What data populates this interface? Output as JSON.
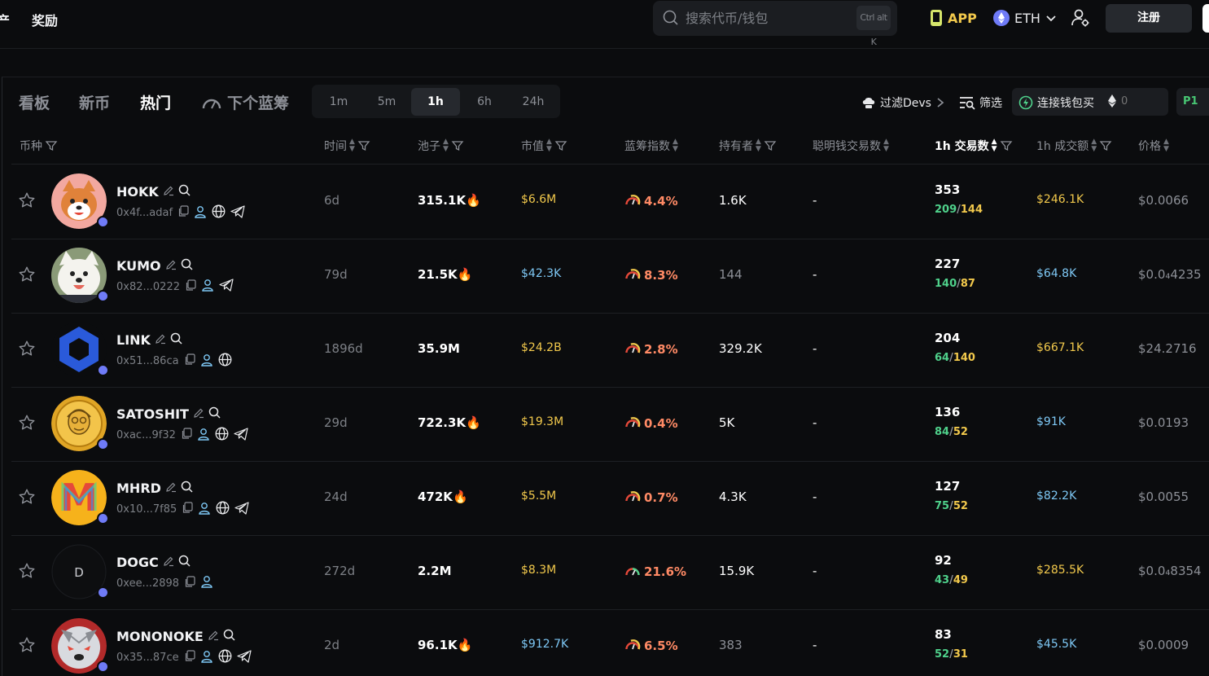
{
  "topbar": {
    "nav_assets_partial": "产",
    "nav_rewards": "奖励",
    "search_placeholder": "搜索代币/钱包",
    "search_shortcut": "Ctrl alt K",
    "app_label": "APP",
    "chain_label": "ETH",
    "signup_label": "注册"
  },
  "tabs": [
    {
      "label": "看板"
    },
    {
      "label": "新币"
    },
    {
      "label": "热门"
    },
    {
      "label": "下个蓝筹"
    }
  ],
  "time_ranges": [
    {
      "label": "1m"
    },
    {
      "label": "5m"
    },
    {
      "label": "1h"
    },
    {
      "label": "6h"
    },
    {
      "label": "24h"
    }
  ],
  "toolbar": {
    "filter_devs": "过滤Devs",
    "filter": "筛选",
    "wallet_buy": "连接钱包买",
    "buy_amount": "0",
    "preset": "P1"
  },
  "columns": {
    "token": "币种",
    "age": "时间",
    "pool": "池子",
    "market_cap": "市值",
    "bluechip": "蓝筹指数",
    "holders": "持有者",
    "smart_tx": "聪明钱交易数",
    "tx_1h": "1h 交易数",
    "vol_1h": "1h 成交额",
    "price": "价格"
  },
  "rows": [
    {
      "symbol": "HOKK",
      "address": "0x4f...adaf",
      "age": "6d",
      "pool": "315.1K",
      "market_cap": "$6.6M",
      "bluechip": "4.4%",
      "holders": "1.6K",
      "smart_tx": "-",
      "tx": "353",
      "buys": "209",
      "sells": "144",
      "volume": "$246.1K",
      "price": "$0.0066",
      "avatar_color": "#f08a72",
      "hot": true
    },
    {
      "symbol": "KUMO",
      "address": "0x82...0222",
      "age": "79d",
      "pool": "21.5K",
      "market_cap": "$42.3K",
      "bluechip": "8.3%",
      "holders": "144",
      "smart_tx": "-",
      "tx": "227",
      "buys": "140",
      "sells": "87",
      "volume": "$64.8K",
      "price": "$0.0₄4235",
      "avatar_color": "#d8d8d2",
      "hot": true
    },
    {
      "symbol": "LINK",
      "address": "0x51...86ca",
      "age": "1896d",
      "pool": "35.9M",
      "market_cap": "$24.2B",
      "bluechip": "2.8%",
      "holders": "329.2K",
      "smart_tx": "-",
      "tx": "204",
      "buys": "64",
      "sells": "140",
      "volume": "$667.1K",
      "price": "$24.2716",
      "avatar_color": "#2a5ada",
      "hot": false
    },
    {
      "symbol": "SATOSHIT",
      "address": "0xac...9f32",
      "age": "29d",
      "pool": "722.3K",
      "market_cap": "$19.3M",
      "bluechip": "0.4%",
      "holders": "5K",
      "smart_tx": "-",
      "tx": "136",
      "buys": "84",
      "sells": "52",
      "volume": "$91K",
      "price": "$0.0193",
      "avatar_color": "#e0a525",
      "hot": true
    },
    {
      "symbol": "MHRD",
      "address": "0x10...7f85",
      "age": "24d",
      "pool": "472K",
      "market_cap": "$5.5M",
      "bluechip": "0.7%",
      "holders": "4.3K",
      "smart_tx": "-",
      "tx": "127",
      "buys": "75",
      "sells": "52",
      "volume": "$82.2K",
      "price": "$0.0055",
      "avatar_color": "#f6b21b",
      "hot": true
    },
    {
      "symbol": "DOGC",
      "address": "0xee...2898",
      "age": "272d",
      "pool": "2.2M",
      "market_cap": "$8.3M",
      "bluechip": "21.6%",
      "holders": "15.9K",
      "smart_tx": "-",
      "tx": "92",
      "buys": "43",
      "sells": "49",
      "volume": "$285.5K",
      "price": "$0.0₄8354",
      "avatar_letter": "D",
      "avatar_color": "#0b0c0e",
      "hot": false
    },
    {
      "symbol": "MONONOKE",
      "address": "0x35...87ce",
      "age": "2d",
      "pool": "96.1K",
      "market_cap": "$912.7K",
      "bluechip": "6.5%",
      "holders": "383",
      "smart_tx": "-",
      "tx": "83",
      "buys": "52",
      "sells": "31",
      "volume": "$45.5K",
      "price": "$0.0009",
      "avatar_color": "#b22a2a",
      "hot": true
    }
  ]
}
